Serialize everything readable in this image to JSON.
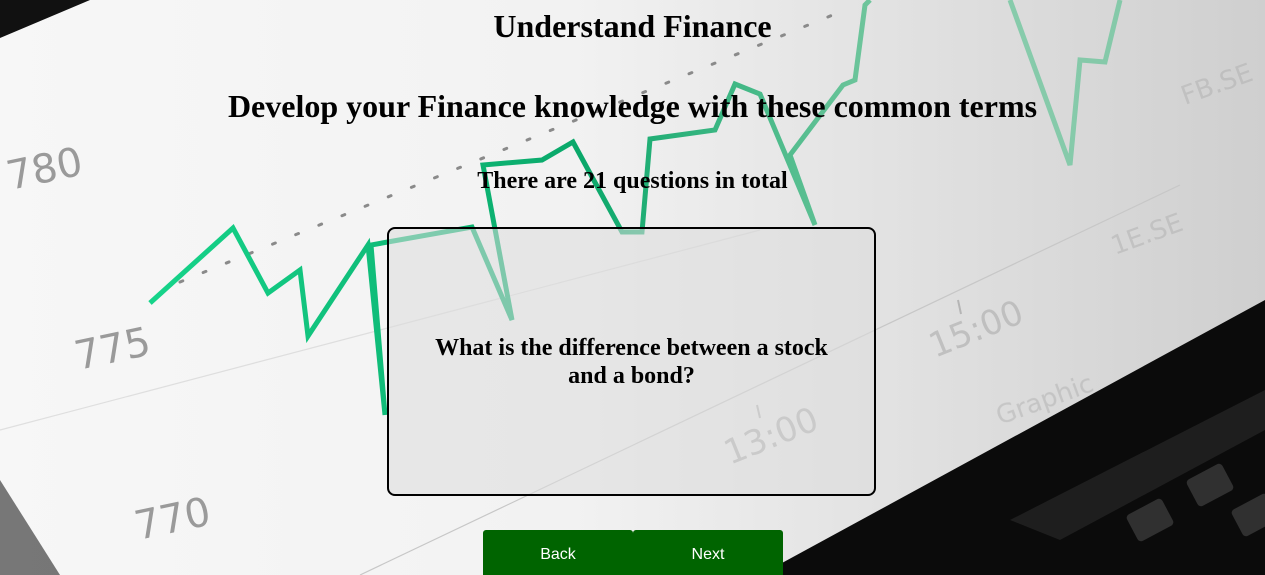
{
  "page": {
    "title": "Understand Finance",
    "subtitle": "Develop your Finance knowledge with these common terms",
    "question_count_text": "There are 21 questions in total"
  },
  "card": {
    "question": "What is the difference between a stock and a bond?"
  },
  "nav": {
    "back_label": "Back",
    "next_label": "Next"
  },
  "background": {
    "description_icon": "stock-chart-photo",
    "axis_labels": [
      "780",
      "775",
      "770",
      "13:00",
      "15:00"
    ],
    "line_color": "#00b86b",
    "button_color": "#006400"
  }
}
